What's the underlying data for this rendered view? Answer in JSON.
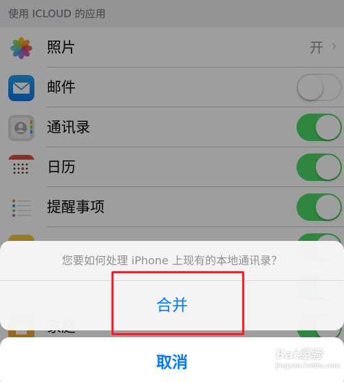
{
  "section_header": "使用 ICLOUD 的应用",
  "apps": [
    {
      "name": "照片",
      "icon": "photos-icon",
      "value": "开",
      "chevron": "›"
    },
    {
      "name": "邮件",
      "icon": "mail-icon",
      "toggle": false
    },
    {
      "name": "通讯录",
      "icon": "contacts-icon",
      "toggle": true
    },
    {
      "name": "日历",
      "icon": "calendar-icon",
      "toggle": true
    },
    {
      "name": "提醒事项",
      "icon": "reminders-icon",
      "toggle": true
    },
    {
      "name": "",
      "icon": "notes-icon",
      "toggle": true
    },
    {
      "name": "",
      "icon": "safari-icon",
      "toggle": true
    },
    {
      "name": "家庭",
      "icon": "home-icon",
      "toggle": true
    }
  ],
  "sheet": {
    "message": "您要如何处理 iPhone 上现有的本地通讯录？",
    "merge_label": "合并",
    "cancel_label": "取消"
  },
  "watermark": {
    "text": "Bai经验",
    "sub": "jingyan.baidu.com"
  },
  "colors": {
    "accent": "#007aff",
    "toggle_on": "#4cd964",
    "highlight": "#e3262d"
  }
}
